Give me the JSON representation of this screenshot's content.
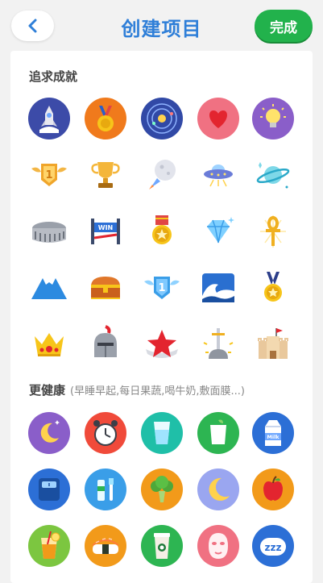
{
  "header": {
    "title": "创建项目",
    "done_label": "完成"
  },
  "sections": [
    {
      "title": "追求成就",
      "hint": ""
    },
    {
      "title": "更健康",
      "hint": "(早睡早起,每日果蔬,喝牛奶,敷面膜...)"
    }
  ],
  "icon_texts": {
    "win": "WIN",
    "badge_num": "1",
    "milk": "Milk",
    "zzz": "zzz"
  },
  "colors": {
    "accent_blue": "#2f7fd8",
    "done_green": "#22b24c"
  },
  "icons": {
    "achievement": [
      "rocket-launch-icon",
      "gold-medal-icon",
      "galaxy-icon",
      "heart-icon",
      "light-bulb-icon",
      "winged-number-one-badge-icon",
      "trophy-icon",
      "moon-rocket-icon",
      "ufo-icon",
      "saturn-planet-icon",
      "colosseum-icon",
      "win-finish-line-icon",
      "star-medal-icon",
      "diamond-icon",
      "ankh-icon",
      "mount-fuji-icon",
      "treasure-chest-icon",
      "blue-winged-number-one-icon",
      "wave-icon",
      "blue-ribbon-medal-icon",
      "crown-icon",
      "knight-helmet-icon",
      "red-star-icon",
      "sword-in-stone-icon",
      "castle-icon"
    ],
    "health": [
      "moon-sleep-icon",
      "alarm-clock-icon",
      "glass-of-water-icon",
      "tea-cup-icon",
      "milk-carton-icon",
      "bathroom-scale-icon",
      "toothbrush-toothpaste-icon",
      "broccoli-icon",
      "crescent-moon-icon",
      "apple-icon",
      "lemonade-icon",
      "sushi-icon",
      "coffee-cup-icon",
      "face-mask-icon",
      "zzz-sleep-icon"
    ]
  }
}
